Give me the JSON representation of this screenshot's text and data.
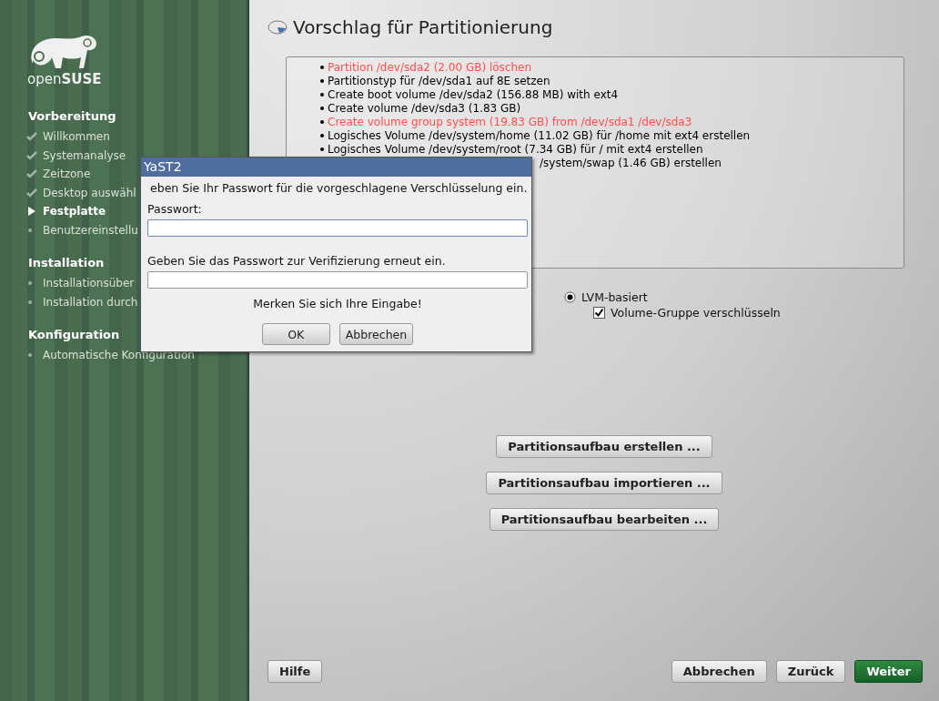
{
  "sidebar": {
    "logo": "open**SUSE**",
    "sections": [
      {
        "title": "Vorbereitung",
        "items": [
          {
            "label": "Willkommen",
            "kind": "done"
          },
          {
            "label": "Systemanalyse",
            "kind": "done"
          },
          {
            "label": "Zeitzone",
            "kind": "done"
          },
          {
            "label": "Desktop auswähl",
            "kind": "done"
          },
          {
            "label": "Festplatte",
            "kind": "current"
          },
          {
            "label": "Benutzereinstellu",
            "kind": "pending"
          }
        ]
      },
      {
        "title": "Installation",
        "items": [
          {
            "label": "Installationsüber",
            "kind": "pending"
          },
          {
            "label": "Installation durch",
            "kind": "pending"
          }
        ]
      },
      {
        "title": "Konfiguration",
        "items": [
          {
            "label": "Automatische Konfiguration",
            "kind": "pending"
          }
        ]
      }
    ]
  },
  "page": {
    "title": "Vorschlag für Partitionierung",
    "proposal": [
      {
        "text": "Partition /dev/sda2 (2.00 GB) löschen",
        "color": "#ff4d4d",
        "kind": "full"
      },
      {
        "text": "Partitionstyp für /dev/sda1 auf 8E setzen",
        "color": "#000000",
        "kind": "full"
      },
      {
        "text": "Create boot volume /dev/sda2 (156.88 MB) with ext4",
        "color": "#000000",
        "kind": "full"
      },
      {
        "text": "Create volume /dev/sda3 (1.83 GB)",
        "color": "#000000",
        "kind": "full"
      },
      {
        "text": "Create volume group system (19.83 GB) from /dev/sda1 /dev/sda3",
        "color": "#ff4d4d",
        "kind": "full"
      },
      {
        "text": "Logisches Volume /dev/system/home (11.02 GB) für /home mit ext4 erstellen",
        "color": "#000000",
        "kind": "full"
      },
      {
        "text": "Logisches Volume /dev/system/root (7.34 GB) für / mit ext4 erstellen",
        "color": "#000000",
        "kind": "full"
      },
      {
        "text": "/system/swap (1.46 GB) erstellen",
        "color": "#000000",
        "kind": "covered"
      }
    ],
    "options": [
      {
        "kind": "radio",
        "label": "LVM-basiert",
        "selected": true
      },
      {
        "kind": "checkbox",
        "label": "Volume-Gruppe verschlüsseln",
        "checked": true
      }
    ],
    "actions": [
      "Partitionsaufbau erstellen ...",
      "Partitionsaufbau importieren ...",
      "Partitionsaufbau bearbeiten ..."
    ],
    "footer": {
      "help": "Hilfe",
      "buttons": [
        {
          "label": "Abbrechen",
          "kind": "normal"
        },
        {
          "label": "Zurück",
          "kind": "normal"
        },
        {
          "label": "Weiter",
          "kind": "default"
        }
      ]
    }
  },
  "dialog": {
    "title": "YaST2",
    "message": "eben Sie Ihr Passwort für die vorgeschlagene Verschlüsselung ein.",
    "fields": [
      {
        "label": "Passwort:",
        "focused": true
      },
      {
        "label": "Geben Sie das Passwort zur Verifizierung erneut ein.",
        "focused": false
      }
    ],
    "note": "Merken Sie sich Ihre Eingabe!",
    "buttons": [
      "OK",
      "Abbrechen"
    ]
  }
}
